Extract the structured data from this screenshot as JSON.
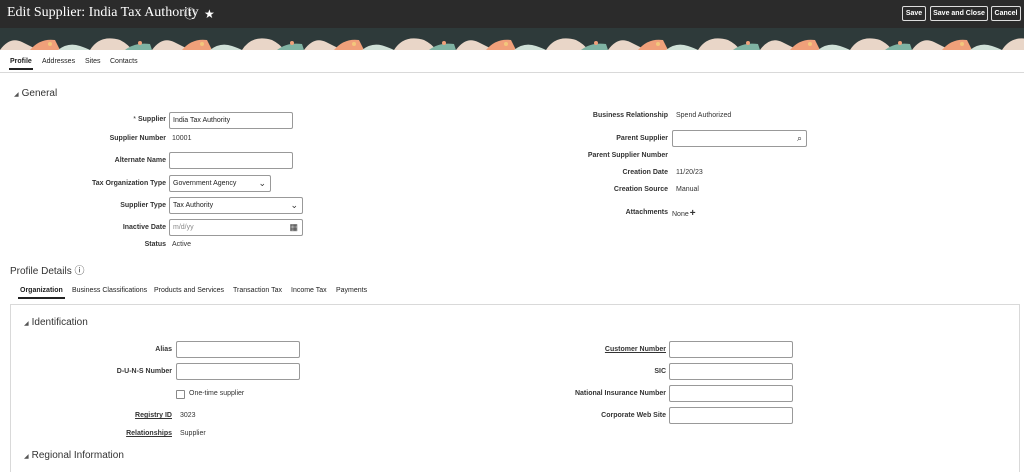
{
  "header": {
    "title": "Edit Supplier: India Tax Authority",
    "save": "Save",
    "save_close": "Save and Close",
    "cancel": "Cancel"
  },
  "tabs": [
    "Profile",
    "Addresses",
    "Sites",
    "Contacts"
  ],
  "general": {
    "title": "General",
    "supplier_label": "Supplier",
    "supplier_value": "India Tax Authority",
    "supplier_number_label": "Supplier Number",
    "supplier_number": "10001",
    "alternate_name_label": "Alternate Name",
    "tax_org_type_label": "Tax Organization Type",
    "tax_org_type": "Government Agency",
    "supplier_type_label": "Supplier Type",
    "supplier_type": "Tax Authority",
    "inactive_date_label": "Inactive Date",
    "inactive_date_placeholder": "m/d/yy",
    "status_label": "Status",
    "status": "Active",
    "business_relationship_label": "Business Relationship",
    "business_relationship": "Spend Authorized",
    "parent_supplier_label": "Parent Supplier",
    "parent_supplier_number_label": "Parent Supplier Number",
    "creation_date_label": "Creation Date",
    "creation_date": "11/20/23",
    "creation_source_label": "Creation Source",
    "creation_source": "Manual",
    "attachments_label": "Attachments",
    "attachments": "None"
  },
  "profile_details": {
    "title": "Profile Details",
    "tabs": [
      "Organization",
      "Business Classifications",
      "Products and Services",
      "Transaction Tax",
      "Income Tax",
      "Payments"
    ]
  },
  "identification": {
    "title": "Identification",
    "alias_label": "Alias",
    "duns_label": "D-U-N-S Number",
    "one_time_label": "One-time supplier",
    "registry_id_label": "Registry ID",
    "registry_id": "3023",
    "relationships_label": "Relationships",
    "relationships": "Supplier",
    "customer_number_label": "Customer Number",
    "sic_label": "SIC",
    "national_insurance_label": "National Insurance Number",
    "corporate_web_label": "Corporate Web Site"
  },
  "regional": {
    "title": "Regional Information"
  }
}
